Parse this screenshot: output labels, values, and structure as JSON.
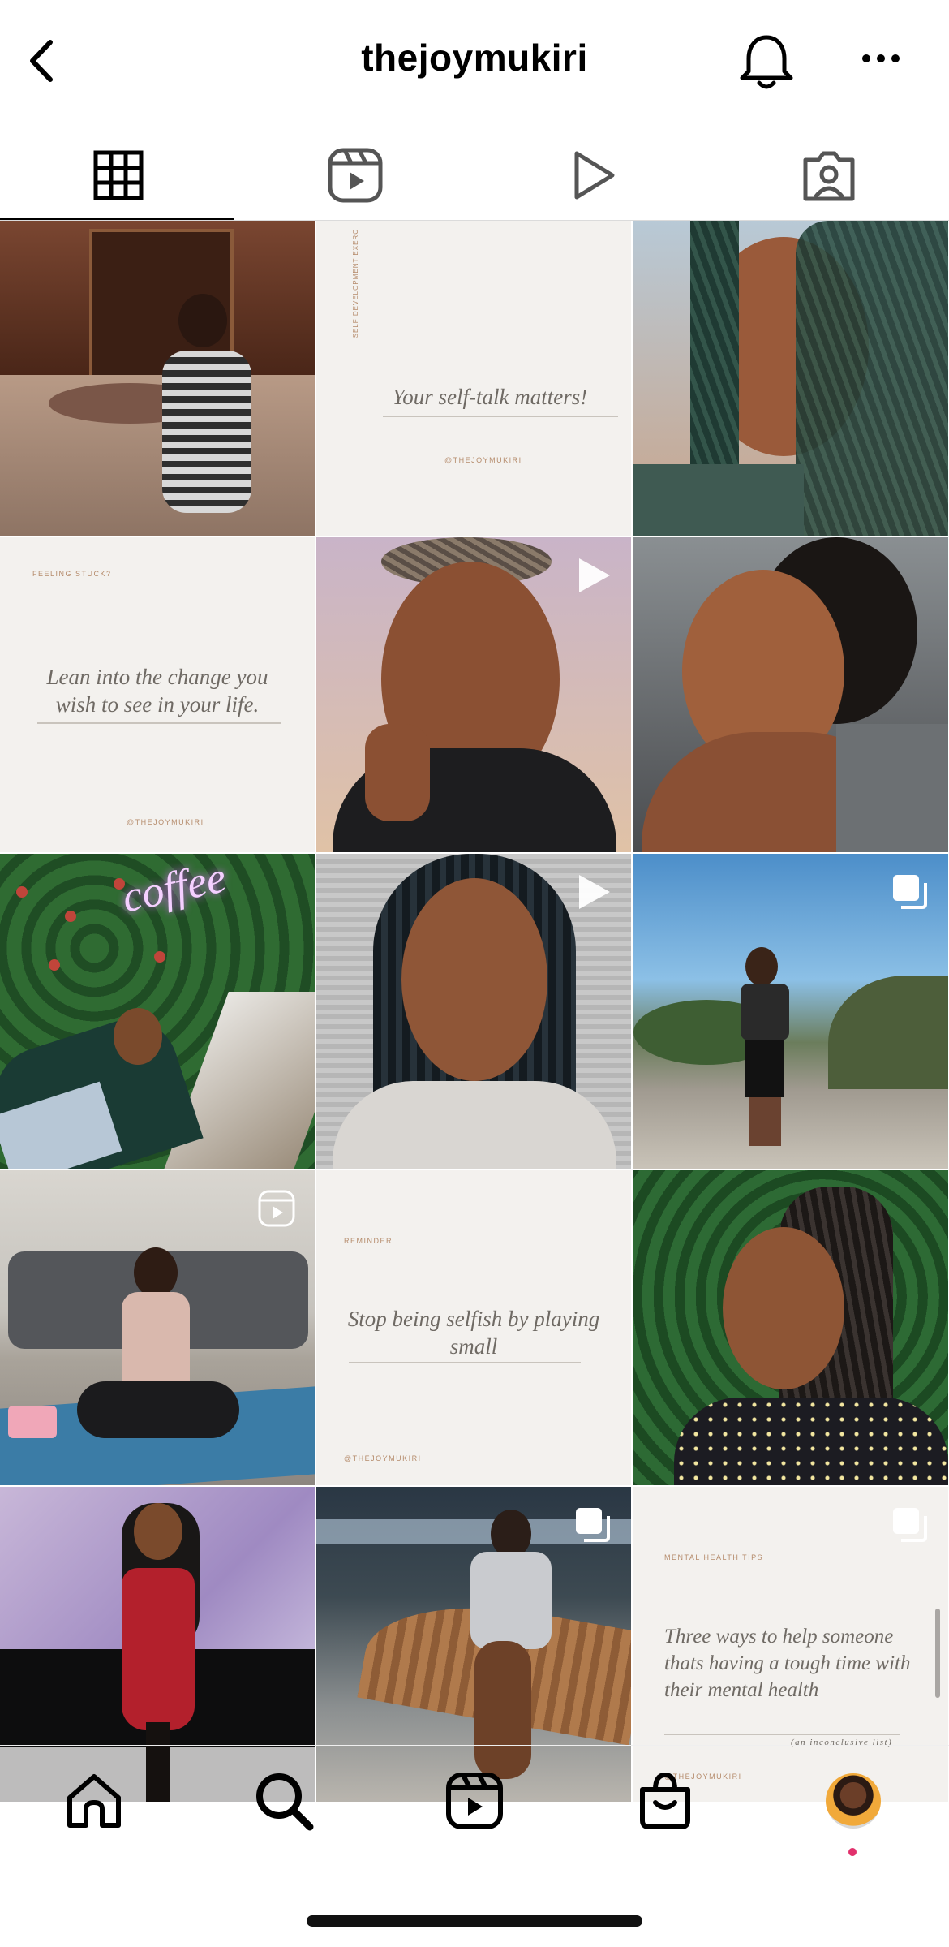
{
  "header": {
    "title": "thejoymukiri",
    "icons": [
      "chevron-left-icon",
      "bell-icon",
      "more-icon"
    ]
  },
  "tabs": [
    {
      "name": "grid",
      "icon": "grid-icon",
      "active": true
    },
    {
      "name": "reels",
      "icon": "reels-icon",
      "active": false
    },
    {
      "name": "videos",
      "icon": "play-icon",
      "active": false
    },
    {
      "name": "tagged",
      "icon": "tagged-icon",
      "active": false
    }
  ],
  "posts": {
    "p2": {
      "text": "Your self-talk matters!",
      "side_label": "SELF DEVELOPMENT EXERC",
      "handle": "@THEJOYMUKIRI"
    },
    "p4": {
      "tag": "FEELING STUCK?",
      "text": "Lean into the change you wish to see in your life.",
      "handle": "@THEJOYMUKIRI"
    },
    "p11": {
      "tag": "REMINDER",
      "text": "Stop being selfish by playing small",
      "handle": "@THEJOYMUKIRI"
    },
    "p15": {
      "tag": "MENTAL HEALTH TIPS",
      "text": "Three ways to help someone thats having a tough time with their mental health",
      "subtext": "(an inconclusive list)",
      "handle": "@THEJOYMUKIRI"
    },
    "p7_neon": "coffee"
  },
  "bottom_nav": [
    {
      "name": "home",
      "icon": "home-icon"
    },
    {
      "name": "search",
      "icon": "search-icon"
    },
    {
      "name": "reels",
      "icon": "reels-icon"
    },
    {
      "name": "shop",
      "icon": "shop-icon"
    },
    {
      "name": "profile",
      "icon": "avatar"
    }
  ],
  "colors": {
    "accent_dot": "#e1306c",
    "tab_active": "#000000"
  }
}
